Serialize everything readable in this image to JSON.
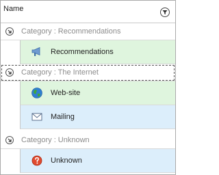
{
  "header": {
    "column_name": "Name",
    "filter_icon": "filter-icon"
  },
  "groups": [
    {
      "label": "Category : Recommendations",
      "rows": [
        {
          "label": "Recommendations",
          "icon": "megaphone-icon",
          "color": "#dff5de"
        }
      ]
    },
    {
      "label": "Category : The Internet",
      "rows": [
        {
          "label": "Web-site",
          "icon": "globe-icon",
          "color": "#dff5de"
        },
        {
          "label": "Mailing",
          "icon": "envelope-icon",
          "color": "#dceefb"
        }
      ]
    },
    {
      "label": "Category : Unknown",
      "rows": [
        {
          "label": "Unknown",
          "icon": "question-icon",
          "color": "#dceefb"
        }
      ]
    }
  ]
}
